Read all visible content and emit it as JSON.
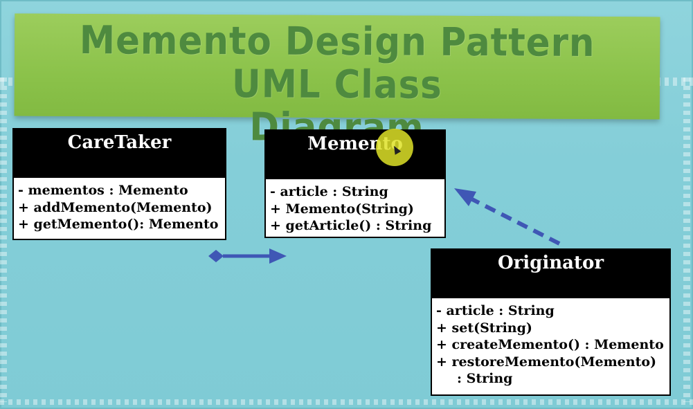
{
  "title": {
    "line1": "Memento Design Pattern UML Class",
    "line2": "Diagram"
  },
  "classes": {
    "caretaker": {
      "name": "CareTaker",
      "members": [
        "- mementos : Memento",
        "+ addMemento(Memento)",
        "+ getMemento(): Memento"
      ]
    },
    "memento": {
      "name": "Memento",
      "members": [
        "- article : String",
        "+ Memento(String)",
        "+ getArticle() : String"
      ]
    },
    "originator": {
      "name": "Originator",
      "members": [
        "- article : String",
        "+ set(String)",
        "+ createMemento() : Memento",
        "+ restoreMemento(Memento)",
        ": String"
      ]
    }
  },
  "colors": {
    "background": "#84ced8",
    "banner": "#8fc44e",
    "banner_text": "#4e8a3f",
    "connector": "#3f57b5",
    "cursor_highlight": "#dee228"
  },
  "connectors": [
    {
      "from": "caretaker",
      "to": "memento",
      "type": "aggregation"
    },
    {
      "from": "originator",
      "to": "memento",
      "type": "dependency"
    }
  ]
}
